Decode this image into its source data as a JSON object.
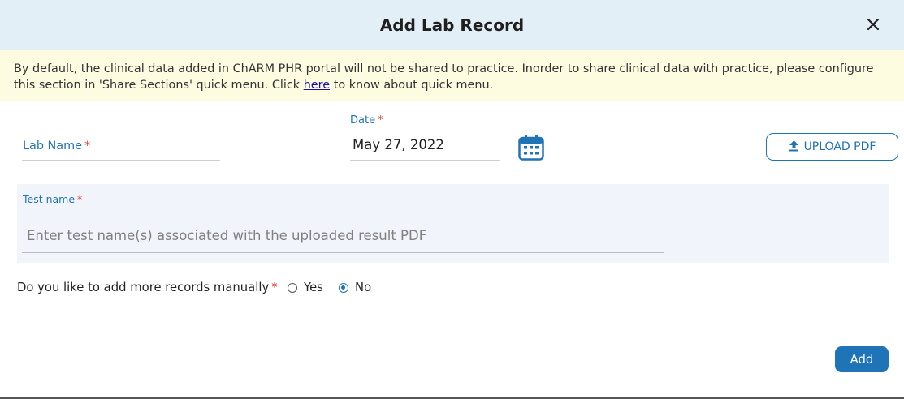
{
  "dialog": {
    "title": "Add Lab Record",
    "close_icon": "close-icon"
  },
  "notice": {
    "text_before": "By default, the clinical data added in ChARM PHR portal will not be shared to practice. Inorder to share clinical data with practice, please configure this section in 'Share Sections' quick menu. Click ",
    "link_text": "here",
    "text_after": " to know about quick menu."
  },
  "form": {
    "lab_name_label": "Lab Name",
    "required_mark": "*",
    "date_label": "Date",
    "date_value": "May 27, 2022",
    "calendar_icon": "calendar-icon",
    "upload_label": "UPLOAD PDF",
    "upload_icon": "upload-icon",
    "test_name_label": "Test name",
    "test_name_placeholder": "Enter test name(s) associated with the uploaded result PDF",
    "more_records_question": "Do you like to add more records manually",
    "options": [
      {
        "label": "Yes",
        "checked": false
      },
      {
        "label": "No",
        "checked": true
      }
    ],
    "add_label": "Add"
  },
  "colors": {
    "accent": "#1f73b7",
    "header_bg": "#e3eff7",
    "notice_bg": "#fdfbe0",
    "required": "#e53935"
  }
}
